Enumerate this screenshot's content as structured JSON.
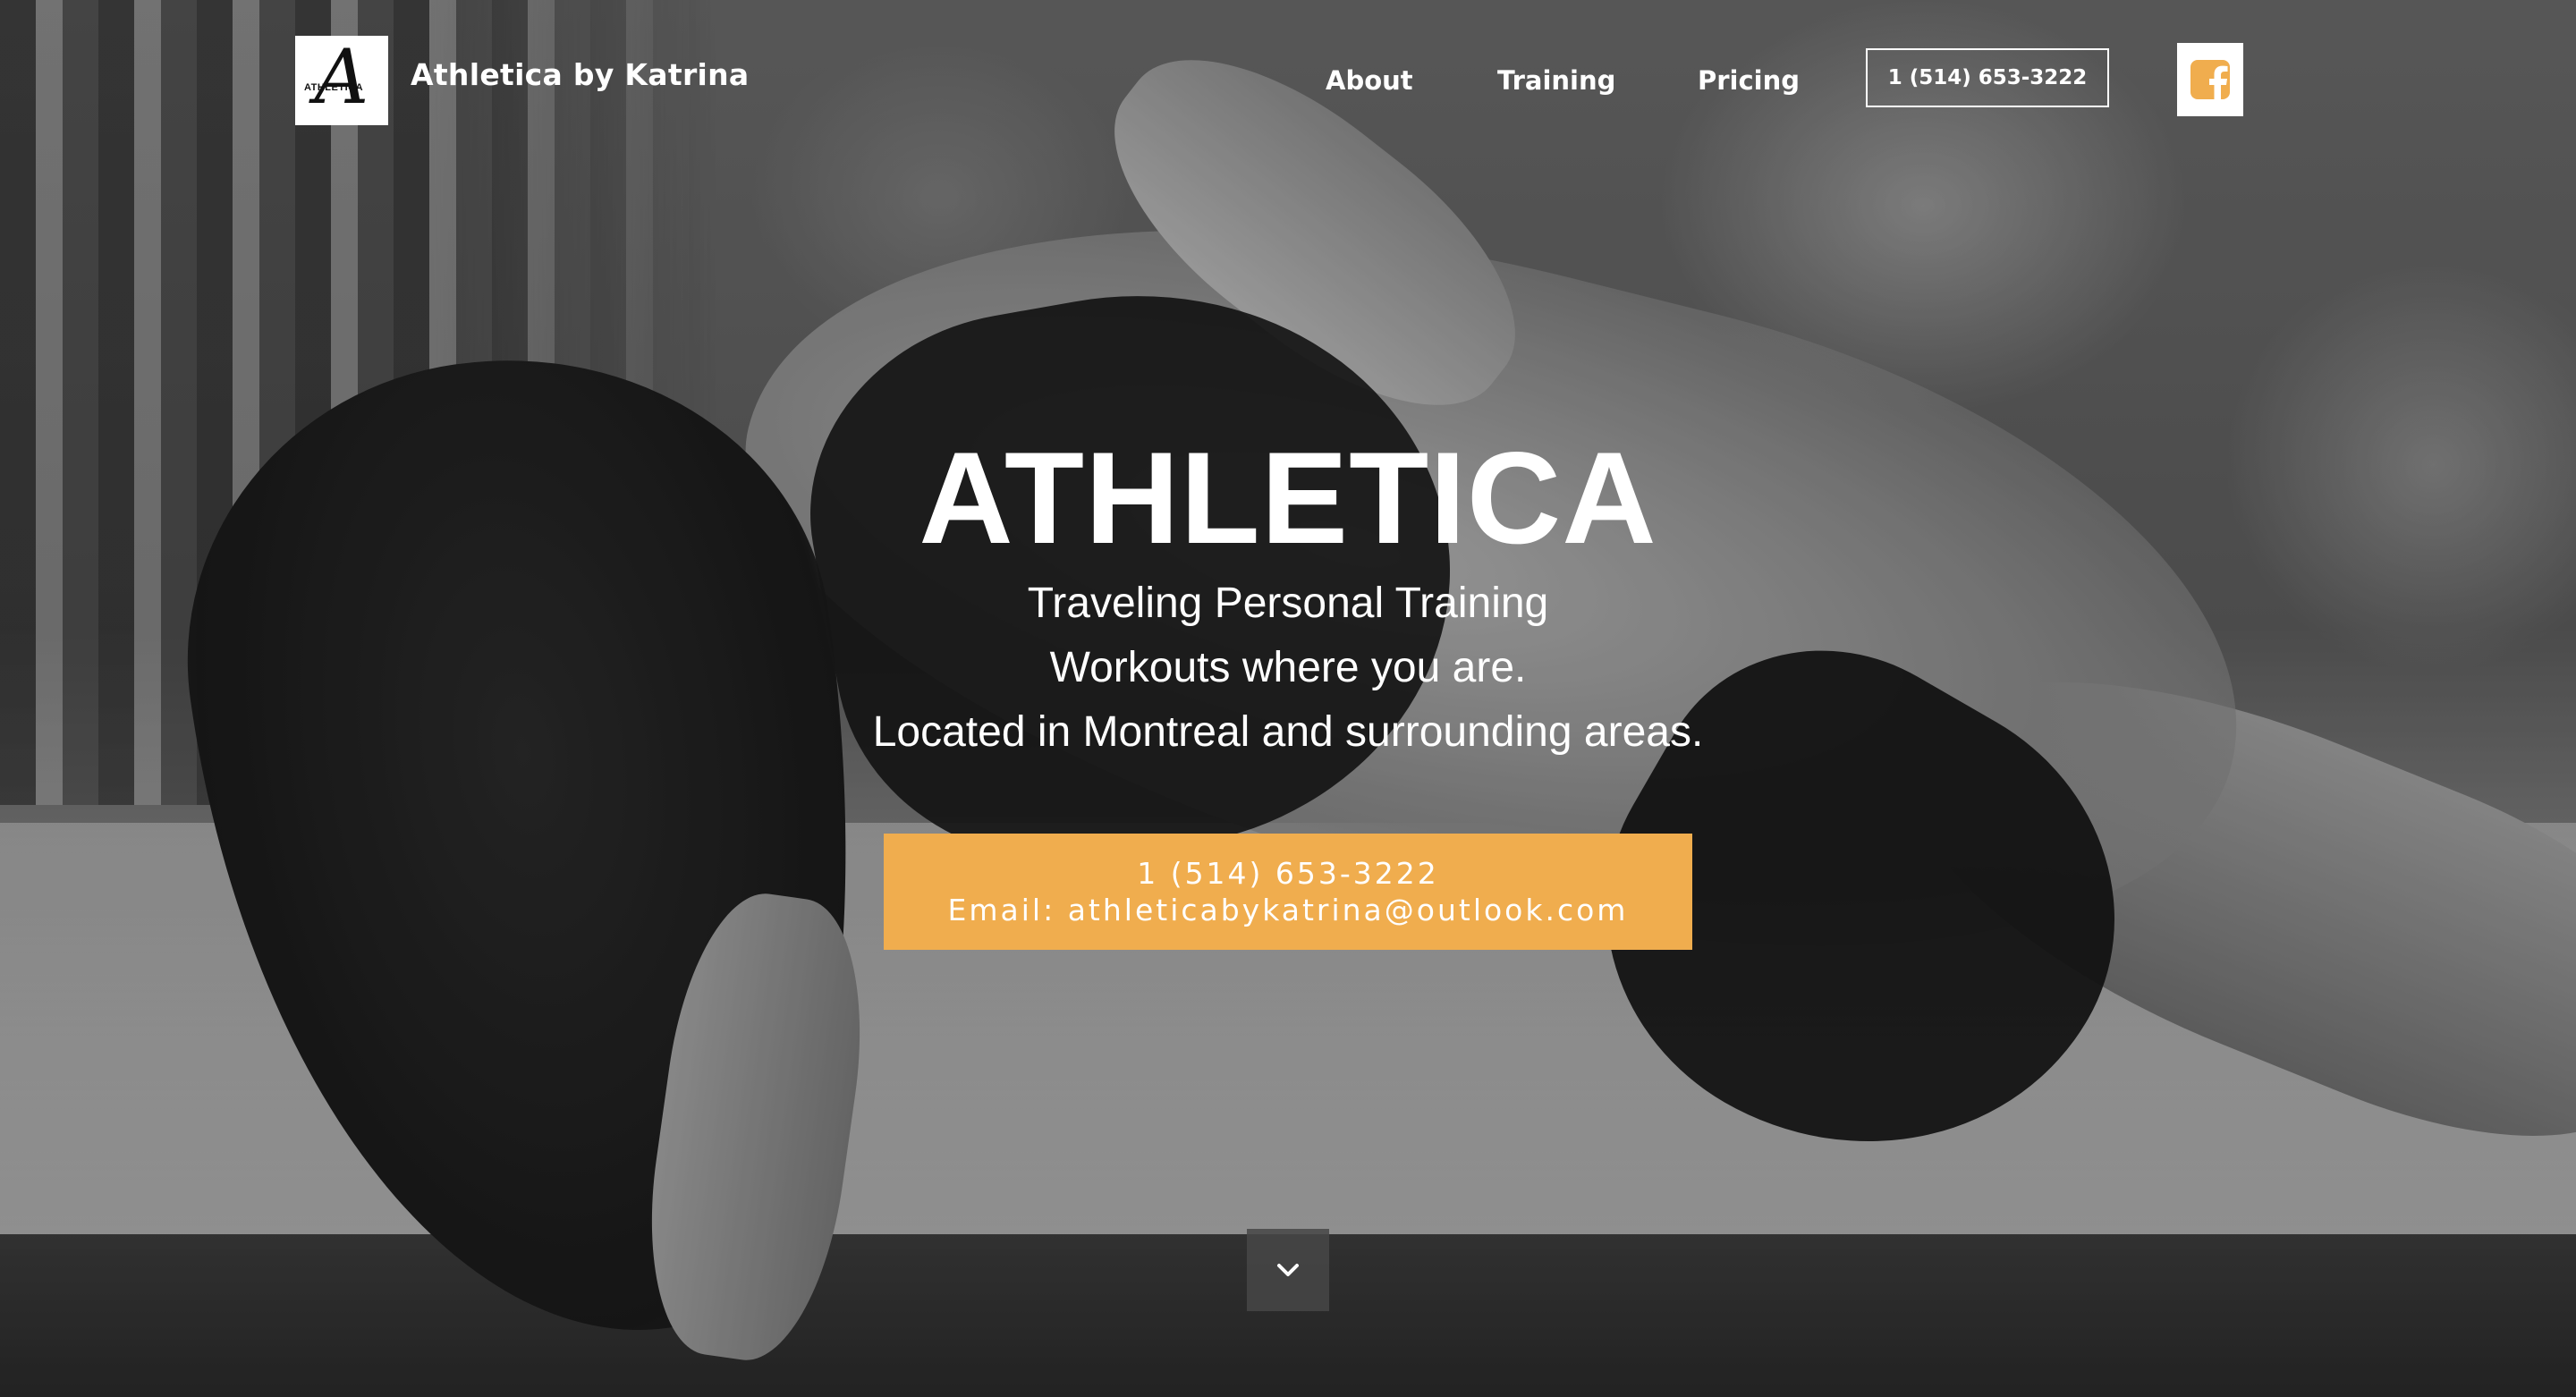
{
  "header": {
    "logo_text": "ATHLETICA",
    "brand": "Athletica by Katrina",
    "nav": {
      "about": "About",
      "training": "Training",
      "pricing": "Pricing"
    },
    "phone_button": "1 (514) 653-3222",
    "social_icon": "facebook-icon"
  },
  "hero": {
    "title": "ATHLETICA",
    "lines": [
      "Traveling Personal Training",
      "Workouts where you are.",
      "Located in Montreal and surrounding areas."
    ],
    "cta": {
      "phone": "1 (514) 653-3222",
      "email": "Email: athleticabykatrina@outlook.com"
    },
    "scroll_icon": "chevron-down-icon"
  },
  "colors": {
    "accent": "#f0ad4e",
    "text": "#ffffff"
  }
}
